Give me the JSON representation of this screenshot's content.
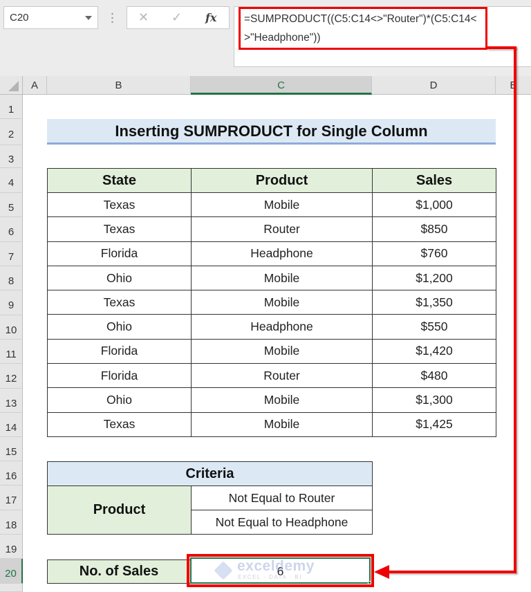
{
  "formula_bar": {
    "name_box": "C20",
    "cancel_icon": "✕",
    "enter_icon": "✓",
    "fx_label": "fx",
    "formula": "=SUMPRODUCT((C5:C14<>\"Router\")*(C5:C14<>\"Headphone\"))"
  },
  "columns": [
    "A",
    "B",
    "C",
    "D",
    "E"
  ],
  "selected_column": "C",
  "rows": [
    "1",
    "2",
    "3",
    "4",
    "5",
    "6",
    "7",
    "8",
    "9",
    "10",
    "11",
    "12",
    "13",
    "14",
    "15",
    "16",
    "17",
    "18",
    "19",
    "20"
  ],
  "selected_row": "20",
  "sheet": {
    "title": "Inserting SUMPRODUCT for Single Column",
    "table": {
      "headers": [
        "State",
        "Product",
        "Sales"
      ],
      "rows": [
        [
          "Texas",
          "Mobile",
          "$1,000"
        ],
        [
          "Texas",
          "Router",
          "$850"
        ],
        [
          "Florida",
          "Headphone",
          "$760"
        ],
        [
          "Ohio",
          "Mobile",
          "$1,200"
        ],
        [
          "Texas",
          "Mobile",
          "$1,350"
        ],
        [
          "Ohio",
          "Headphone",
          "$550"
        ],
        [
          "Florida",
          "Mobile",
          "$1,420"
        ],
        [
          "Florida",
          "Router",
          "$480"
        ],
        [
          "Ohio",
          "Mobile",
          "$1,300"
        ],
        [
          "Texas",
          "Mobile",
          "$1,425"
        ]
      ]
    },
    "criteria": {
      "header": "Criteria",
      "label": "Product",
      "values": [
        "Not Equal to Router",
        "Not Equal to Headphone"
      ]
    },
    "result": {
      "label": "No. of Sales",
      "value": "6"
    }
  },
  "watermark": {
    "name": "exceldemy",
    "tagline": "EXCEL · DATA · BI"
  },
  "annotation_color": "#f00000"
}
